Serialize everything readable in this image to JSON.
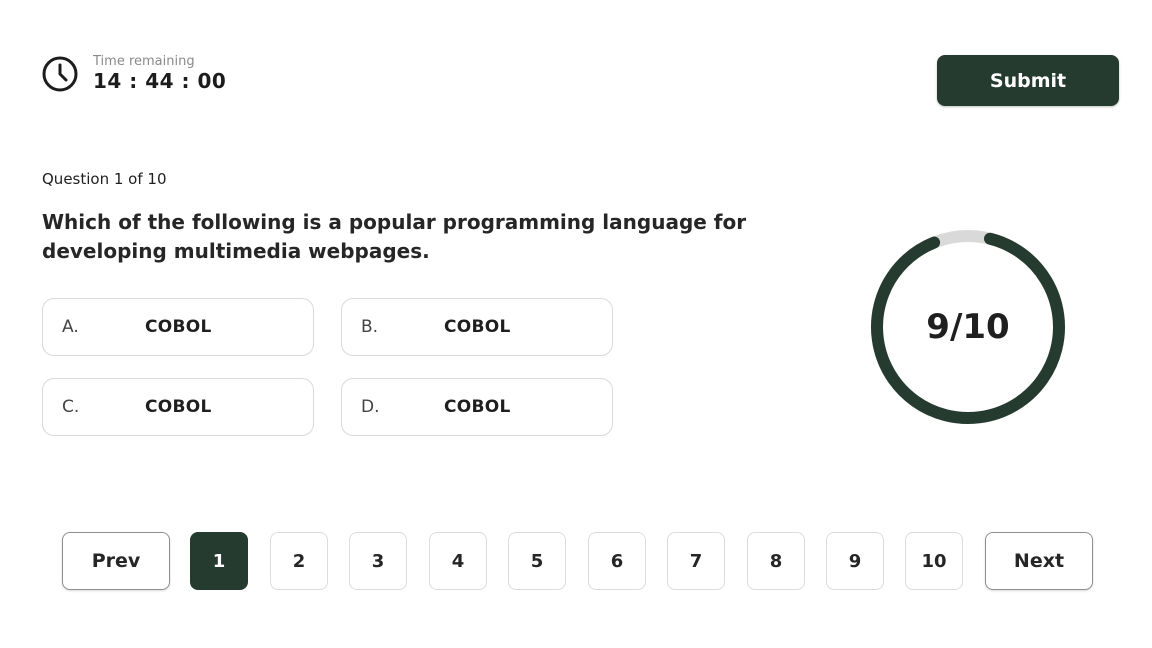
{
  "timer": {
    "label": "Time remaining",
    "value": "14 : 44 : 00",
    "icon": "clock-icon"
  },
  "submit": {
    "label": "Submit"
  },
  "question": {
    "counter": "Question 1 of 10",
    "text": "Which of the following is a popular programming language for developing multimedia webpages."
  },
  "options": [
    {
      "letter": "A.",
      "answer": "COBOL"
    },
    {
      "letter": "B.",
      "answer": "COBOL"
    },
    {
      "letter": "C.",
      "answer": "COBOL"
    },
    {
      "letter": "D.",
      "answer": "COBOL"
    }
  ],
  "progress": {
    "label": "9/10",
    "answered": 9,
    "total": 10
  },
  "pagination": {
    "prev_label": "Prev",
    "next_label": "Next",
    "pages": [
      "1",
      "2",
      "3",
      "4",
      "5",
      "6",
      "7",
      "8",
      "9",
      "10"
    ],
    "active_page": "1"
  },
  "colors": {
    "accent": "#253b2f",
    "ring_track": "#d9d9d9"
  }
}
